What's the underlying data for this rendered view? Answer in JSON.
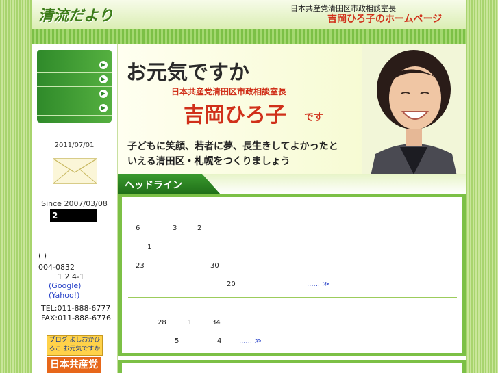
{
  "header": {
    "logo": "清流だより",
    "subtitle_line1": "日本共産党清田区市政相談室長",
    "subtitle_line2": "吉岡ひろ子のホームページ"
  },
  "hero": {
    "greeting": "お元気ですか",
    "role": "日本共産党清田区市政相談室長",
    "name": "吉岡ひろ子",
    "desu": "です",
    "slogan_line1": "子どもに笑顔、若者に夢、長生きしてよかったと",
    "slogan_line2": "いえる清田区・札幌をつくりましょう"
  },
  "headline": {
    "tab_label": "ヘッドライン"
  },
  "sidebar": {
    "nav_items_count": 4,
    "date": "2011/07/01",
    "since": "Since 2007/03/08",
    "counter": "2",
    "paren": "(        )",
    "postal": "004-0832",
    "address": "1  2  4-1",
    "google_link": "(Google)",
    "yahoo_link": "(Yahoo!)",
    "tel": "TEL:011-888-6777",
    "fax": "FAX:011-888-6776",
    "banner_blog": "ブログ よしおかひろこ お元気ですか",
    "banner_jcp": "日本共産党"
  },
  "news": {
    "item1_a": "6",
    "item1_b": "3",
    "item1_c": "2",
    "item1_d": "1",
    "item1_e": "23",
    "item1_f": "30",
    "item1_g": "20",
    "item1_more": "...... ≫",
    "item2_a": "28",
    "item2_b": "1",
    "item2_c": "34",
    "item2_d": "5",
    "item2_e": "4",
    "item2_more": "...... ≫"
  },
  "colors": {
    "accent_green": "#3a9a2e",
    "name_red": "#d0301a",
    "link_blue": "#2a44c8"
  }
}
